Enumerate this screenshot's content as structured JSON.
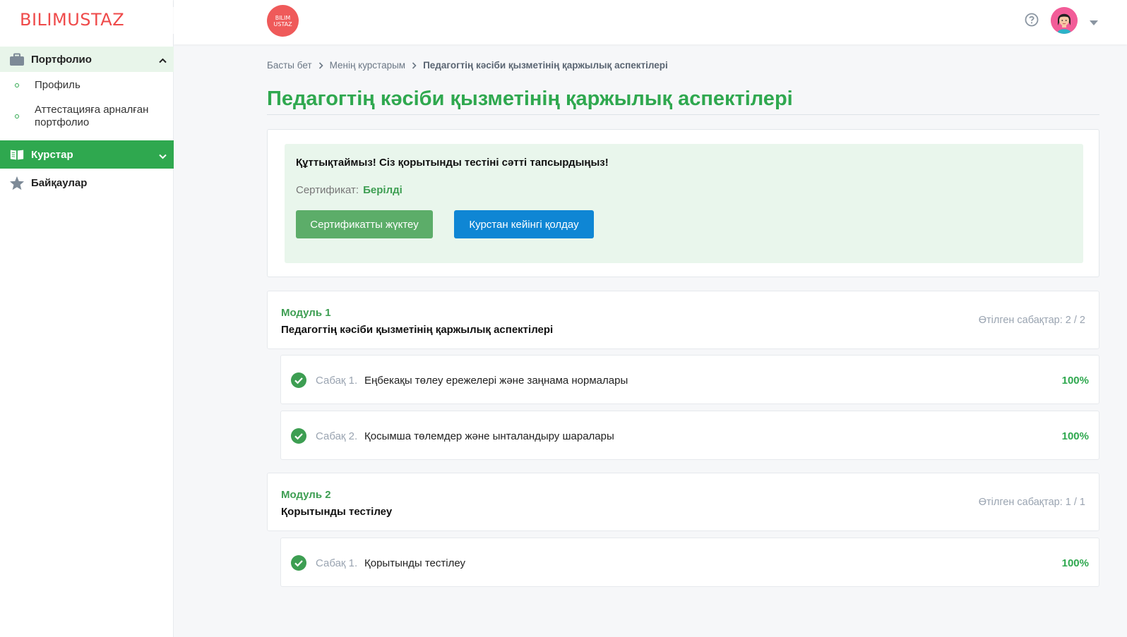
{
  "brand": {
    "logo_text": "BILIMUSTAZ",
    "badge_line1": "BILIM",
    "badge_line2": "USTAZ"
  },
  "sidebar": {
    "portfolio": {
      "label": "Портфолио",
      "items": [
        {
          "label": "Профиль"
        },
        {
          "label": "Аттестацияға арналған портфолио"
        }
      ]
    },
    "courses": {
      "label": "Курстар"
    },
    "competitions": {
      "label": "Байқаулар"
    }
  },
  "breadcrumb": {
    "home": "Басты бет",
    "my_courses": "Менің курстарым",
    "current": "Педагогтің кәсіби қызметінің қаржылық аспектілері"
  },
  "page": {
    "title": "Педагогтің кәсіби қызметінің қаржылық аспектілері"
  },
  "certificate": {
    "message": "Құттықтаймыз! Сіз қорытынды тестіні сәтті тапсырдыңыз!",
    "status_label": "Сертификат:",
    "status_value": "Берілді",
    "download_label": "Сертификатты жүктеу",
    "support_label": "Курстан кейінгі қолдау"
  },
  "modules": [
    {
      "number": "Модуль 1",
      "title": "Педагогтің кәсіби қызметінің қаржылық аспектілері",
      "progress": "Өтілген сабақтар: 2 / 2",
      "lessons": [
        {
          "number": "Сабақ 1.",
          "title": "Еңбекақы төлеу ережелері және заңнама нормалары",
          "percent": "100%"
        },
        {
          "number": "Сабақ 2.",
          "title": "Қосымша төлемдер және ынталандыру шаралары",
          "percent": "100%"
        }
      ]
    },
    {
      "number": "Модуль 2",
      "title": "Қорытынды тестілеу",
      "progress": "Өтілген сабақтар: 1 / 1",
      "lessons": [
        {
          "number": "Сабақ 1.",
          "title": "Қорытынды тестілеу",
          "percent": "100%"
        }
      ]
    }
  ],
  "colors": {
    "accent_green": "#2fa84f",
    "logo_red": "#ef4a4a",
    "button_blue": "#0f86d4"
  }
}
